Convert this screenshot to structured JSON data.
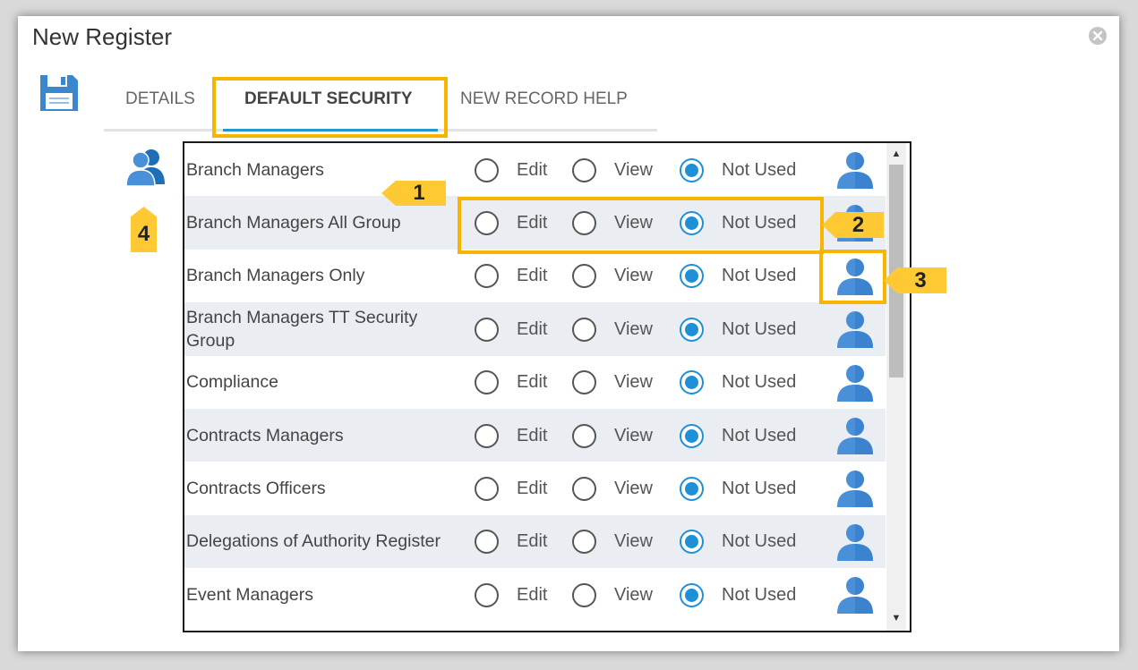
{
  "window": {
    "title": "New Register"
  },
  "tabs": [
    {
      "label": "DETAILS",
      "active": false
    },
    {
      "label": "DEFAULT SECURITY",
      "active": true
    },
    {
      "label": "NEW RECORD HELP",
      "active": false
    }
  ],
  "options": {
    "edit_label": "Edit",
    "view_label": "View",
    "not_used_label": "Not Used"
  },
  "groups": [
    {
      "name": "Branch Managers",
      "access": "Not Used"
    },
    {
      "name": "Branch Managers All Group",
      "access": "Not Used"
    },
    {
      "name": "Branch Managers Only",
      "access": "Not Used"
    },
    {
      "name": "Branch Managers TT Security Group",
      "access": "Not Used"
    },
    {
      "name": "Compliance",
      "access": "Not Used"
    },
    {
      "name": "Contracts Managers",
      "access": "Not Used"
    },
    {
      "name": "Contracts Officers",
      "access": "Not Used"
    },
    {
      "name": "Delegations of Authority Register",
      "access": "Not Used"
    },
    {
      "name": "Event Managers",
      "access": "Not Used"
    }
  ],
  "callouts": {
    "one": "1",
    "two": "2",
    "three": "3",
    "four": "4"
  },
  "colors": {
    "accent": "#2196d3",
    "icon_blue": "#4a90d9",
    "highlight": "#f7b500",
    "callout_bg": "#ffc934",
    "alt_row": "#eaedf1"
  },
  "icons": {
    "save": "floppy-disk-icon",
    "close": "close-circle-icon",
    "group": "user-group-icon",
    "user": "user-icon"
  }
}
